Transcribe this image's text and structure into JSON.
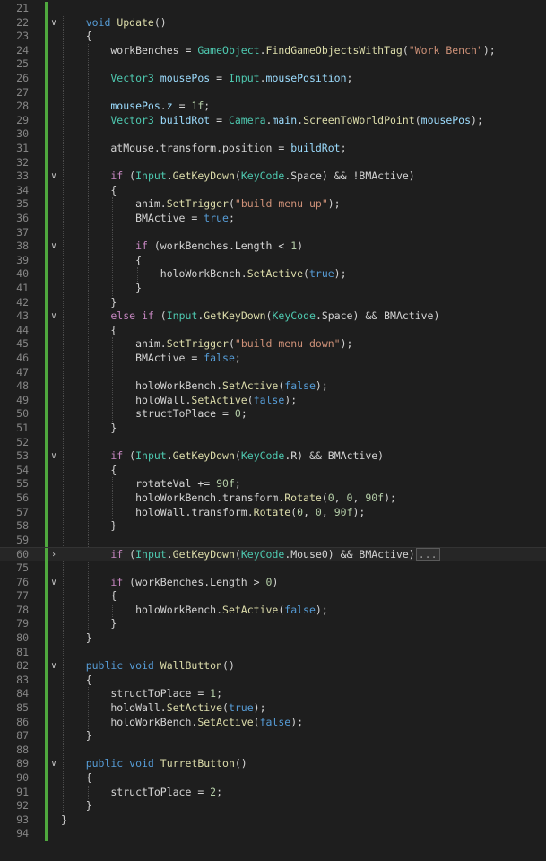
{
  "colors": {
    "background": "#1e1e1e",
    "line_number": "#858585",
    "git_modified_bar": "#4fa83e",
    "keyword": "#569cd6",
    "control": "#c586c0",
    "type": "#4ec9b0",
    "function": "#dcdcaa",
    "variable": "#9cdcfe",
    "string": "#ce9178",
    "number": "#b5cea8",
    "text": "#d4d4d4"
  },
  "editor": {
    "current_line": "60",
    "collapsed_marker": "...",
    "lines": [
      {
        "n": "21",
        "fold": "",
        "tokens": []
      },
      {
        "n": "22",
        "fold": "v",
        "tokens": [
          [
            "kw",
            "    void "
          ],
          [
            "fn",
            "Update"
          ],
          [
            "p",
            "()"
          ]
        ]
      },
      {
        "n": "23",
        "fold": "",
        "tokens": [
          [
            "p",
            "    {"
          ]
        ]
      },
      {
        "n": "24",
        "fold": "",
        "tokens": [
          [
            "p",
            "        workBenches = "
          ],
          [
            "ty",
            "GameObject"
          ],
          [
            "p",
            "."
          ],
          [
            "fn",
            "FindGameObjectsWithTag"
          ],
          [
            "p",
            "("
          ],
          [
            "str",
            "\"Work Bench\""
          ],
          [
            "p",
            ");"
          ]
        ]
      },
      {
        "n": "25",
        "fold": "",
        "tokens": []
      },
      {
        "n": "26",
        "fold": "",
        "tokens": [
          [
            "ty",
            "        Vector3 "
          ],
          [
            "var",
            "mousePos"
          ],
          [
            "p",
            " = "
          ],
          [
            "ty",
            "Input"
          ],
          [
            "p",
            "."
          ],
          [
            "var",
            "mousePosition"
          ],
          [
            "p",
            ";"
          ]
        ]
      },
      {
        "n": "27",
        "fold": "",
        "tokens": []
      },
      {
        "n": "28",
        "fold": "",
        "tokens": [
          [
            "var",
            "        mousePos"
          ],
          [
            "p",
            "."
          ],
          [
            "var",
            "z"
          ],
          [
            "p",
            " = "
          ],
          [
            "num",
            "1f"
          ],
          [
            "p",
            ";"
          ]
        ]
      },
      {
        "n": "29",
        "fold": "",
        "tokens": [
          [
            "ty",
            "        Vector3 "
          ],
          [
            "var",
            "buildRot"
          ],
          [
            "p",
            " = "
          ],
          [
            "ty",
            "Camera"
          ],
          [
            "p",
            "."
          ],
          [
            "var",
            "main"
          ],
          [
            "p",
            "."
          ],
          [
            "fn",
            "ScreenToWorldPoint"
          ],
          [
            "p",
            "("
          ],
          [
            "var",
            "mousePos"
          ],
          [
            "p",
            ");"
          ]
        ]
      },
      {
        "n": "30",
        "fold": "",
        "tokens": []
      },
      {
        "n": "31",
        "fold": "",
        "tokens": [
          [
            "p",
            "        atMouse.transform.position = "
          ],
          [
            "var",
            "buildRot"
          ],
          [
            "p",
            ";"
          ]
        ]
      },
      {
        "n": "32",
        "fold": "",
        "tokens": []
      },
      {
        "n": "33",
        "fold": "v",
        "tokens": [
          [
            "ctl",
            "        if "
          ],
          [
            "p",
            "("
          ],
          [
            "ty",
            "Input"
          ],
          [
            "p",
            "."
          ],
          [
            "fn",
            "GetKeyDown"
          ],
          [
            "p",
            "("
          ],
          [
            "ty",
            "KeyCode"
          ],
          [
            "p",
            ".Space) && !BMActive)"
          ]
        ]
      },
      {
        "n": "34",
        "fold": "",
        "tokens": [
          [
            "p",
            "        {"
          ]
        ]
      },
      {
        "n": "35",
        "fold": "",
        "tokens": [
          [
            "p",
            "            anim."
          ],
          [
            "fn",
            "SetTrigger"
          ],
          [
            "p",
            "("
          ],
          [
            "str",
            "\"build menu up\""
          ],
          [
            "p",
            ");"
          ]
        ]
      },
      {
        "n": "36",
        "fold": "",
        "tokens": [
          [
            "p",
            "            BMActive = "
          ],
          [
            "kw",
            "true"
          ],
          [
            "p",
            ";"
          ]
        ]
      },
      {
        "n": "37",
        "fold": "",
        "tokens": []
      },
      {
        "n": "38",
        "fold": "v",
        "tokens": [
          [
            "ctl",
            "            if "
          ],
          [
            "p",
            "(workBenches.Length < "
          ],
          [
            "num",
            "1"
          ],
          [
            "p",
            ")"
          ]
        ]
      },
      {
        "n": "39",
        "fold": "",
        "tokens": [
          [
            "p",
            "            {"
          ]
        ]
      },
      {
        "n": "40",
        "fold": "",
        "tokens": [
          [
            "p",
            "                holoWorkBench."
          ],
          [
            "fn",
            "SetActive"
          ],
          [
            "p",
            "("
          ],
          [
            "kw",
            "true"
          ],
          [
            "p",
            ");"
          ]
        ]
      },
      {
        "n": "41",
        "fold": "",
        "tokens": [
          [
            "p",
            "            }"
          ]
        ]
      },
      {
        "n": "42",
        "fold": "",
        "tokens": [
          [
            "p",
            "        }"
          ]
        ]
      },
      {
        "n": "43",
        "fold": "v",
        "tokens": [
          [
            "ctl",
            "        else if "
          ],
          [
            "p",
            "("
          ],
          [
            "ty",
            "Input"
          ],
          [
            "p",
            "."
          ],
          [
            "fn",
            "GetKeyDown"
          ],
          [
            "p",
            "("
          ],
          [
            "ty",
            "KeyCode"
          ],
          [
            "p",
            ".Space) && BMActive)"
          ]
        ]
      },
      {
        "n": "44",
        "fold": "",
        "tokens": [
          [
            "p",
            "        {"
          ]
        ]
      },
      {
        "n": "45",
        "fold": "",
        "tokens": [
          [
            "p",
            "            anim."
          ],
          [
            "fn",
            "SetTrigger"
          ],
          [
            "p",
            "("
          ],
          [
            "str",
            "\"build menu down\""
          ],
          [
            "p",
            ");"
          ]
        ]
      },
      {
        "n": "46",
        "fold": "",
        "tokens": [
          [
            "p",
            "            BMActive = "
          ],
          [
            "kw",
            "false"
          ],
          [
            "p",
            ";"
          ]
        ]
      },
      {
        "n": "47",
        "fold": "",
        "tokens": []
      },
      {
        "n": "48",
        "fold": "",
        "tokens": [
          [
            "p",
            "            holoWorkBench."
          ],
          [
            "fn",
            "SetActive"
          ],
          [
            "p",
            "("
          ],
          [
            "kw",
            "false"
          ],
          [
            "p",
            ");"
          ]
        ]
      },
      {
        "n": "49",
        "fold": "",
        "tokens": [
          [
            "p",
            "            holoWall."
          ],
          [
            "fn",
            "SetActive"
          ],
          [
            "p",
            "("
          ],
          [
            "kw",
            "false"
          ],
          [
            "p",
            ");"
          ]
        ]
      },
      {
        "n": "50",
        "fold": "",
        "tokens": [
          [
            "p",
            "            structToPlace = "
          ],
          [
            "num",
            "0"
          ],
          [
            "p",
            ";"
          ]
        ]
      },
      {
        "n": "51",
        "fold": "",
        "tokens": [
          [
            "p",
            "        }"
          ]
        ]
      },
      {
        "n": "52",
        "fold": "",
        "tokens": []
      },
      {
        "n": "53",
        "fold": "v",
        "tokens": [
          [
            "ctl",
            "        if "
          ],
          [
            "p",
            "("
          ],
          [
            "ty",
            "Input"
          ],
          [
            "p",
            "."
          ],
          [
            "fn",
            "GetKeyDown"
          ],
          [
            "p",
            "("
          ],
          [
            "ty",
            "KeyCode"
          ],
          [
            "p",
            ".R) && BMActive)"
          ]
        ]
      },
      {
        "n": "54",
        "fold": "",
        "tokens": [
          [
            "p",
            "        {"
          ]
        ]
      },
      {
        "n": "55",
        "fold": "",
        "tokens": [
          [
            "p",
            "            rotateVal += "
          ],
          [
            "num",
            "90f"
          ],
          [
            "p",
            ";"
          ]
        ]
      },
      {
        "n": "56",
        "fold": "",
        "tokens": [
          [
            "p",
            "            holoWorkBench.transform."
          ],
          [
            "fn",
            "Rotate"
          ],
          [
            "p",
            "("
          ],
          [
            "num",
            "0"
          ],
          [
            "p",
            ", "
          ],
          [
            "num",
            "0"
          ],
          [
            "p",
            ", "
          ],
          [
            "num",
            "90f"
          ],
          [
            "p",
            ");"
          ]
        ]
      },
      {
        "n": "57",
        "fold": "",
        "tokens": [
          [
            "p",
            "            holoWall.transform."
          ],
          [
            "fn",
            "Rotate"
          ],
          [
            "p",
            "("
          ],
          [
            "num",
            "0"
          ],
          [
            "p",
            ", "
          ],
          [
            "num",
            "0"
          ],
          [
            "p",
            ", "
          ],
          [
            "num",
            "90f"
          ],
          [
            "p",
            ");"
          ]
        ]
      },
      {
        "n": "58",
        "fold": "",
        "tokens": [
          [
            "p",
            "        }"
          ]
        ]
      },
      {
        "n": "59",
        "fold": "",
        "tokens": []
      },
      {
        "n": "60",
        "fold": ">",
        "tokens": [
          [
            "ctl",
            "        if "
          ],
          [
            "p",
            "("
          ],
          [
            "ty",
            "Input"
          ],
          [
            "p",
            "."
          ],
          [
            "fn",
            "GetKeyDown"
          ],
          [
            "p",
            "("
          ],
          [
            "ty",
            "KeyCode"
          ],
          [
            "p",
            ".Mouse0) && BMActive)"
          ]
        ]
      },
      {
        "n": "75",
        "fold": "",
        "tokens": []
      },
      {
        "n": "76",
        "fold": "v",
        "tokens": [
          [
            "ctl",
            "        if "
          ],
          [
            "p",
            "(workBenches.Length > "
          ],
          [
            "num",
            "0"
          ],
          [
            "p",
            ")"
          ]
        ]
      },
      {
        "n": "77",
        "fold": "",
        "tokens": [
          [
            "p",
            "        {"
          ]
        ]
      },
      {
        "n": "78",
        "fold": "",
        "tokens": [
          [
            "p",
            "            holoWorkBench."
          ],
          [
            "fn",
            "SetActive"
          ],
          [
            "p",
            "("
          ],
          [
            "kw",
            "false"
          ],
          [
            "p",
            ");"
          ]
        ]
      },
      {
        "n": "79",
        "fold": "",
        "tokens": [
          [
            "p",
            "        }"
          ]
        ]
      },
      {
        "n": "80",
        "fold": "",
        "tokens": [
          [
            "p",
            "    }"
          ]
        ]
      },
      {
        "n": "81",
        "fold": "",
        "tokens": []
      },
      {
        "n": "82",
        "fold": "v",
        "tokens": [
          [
            "kw",
            "    public void "
          ],
          [
            "fn",
            "WallButton"
          ],
          [
            "p",
            "()"
          ]
        ]
      },
      {
        "n": "83",
        "fold": "",
        "tokens": [
          [
            "p",
            "    {"
          ]
        ]
      },
      {
        "n": "84",
        "fold": "",
        "tokens": [
          [
            "p",
            "        structToPlace = "
          ],
          [
            "num",
            "1"
          ],
          [
            "p",
            ";"
          ]
        ]
      },
      {
        "n": "85",
        "fold": "",
        "tokens": [
          [
            "p",
            "        holoWall."
          ],
          [
            "fn",
            "SetActive"
          ],
          [
            "p",
            "("
          ],
          [
            "kw",
            "true"
          ],
          [
            "p",
            ");"
          ]
        ]
      },
      {
        "n": "86",
        "fold": "",
        "tokens": [
          [
            "p",
            "        holoWorkBench."
          ],
          [
            "fn",
            "SetActive"
          ],
          [
            "p",
            "("
          ],
          [
            "kw",
            "false"
          ],
          [
            "p",
            ");"
          ]
        ]
      },
      {
        "n": "87",
        "fold": "",
        "tokens": [
          [
            "p",
            "    }"
          ]
        ]
      },
      {
        "n": "88",
        "fold": "",
        "tokens": []
      },
      {
        "n": "89",
        "fold": "v",
        "tokens": [
          [
            "kw",
            "    public void "
          ],
          [
            "fn",
            "TurretButton"
          ],
          [
            "p",
            "()"
          ]
        ]
      },
      {
        "n": "90",
        "fold": "",
        "tokens": [
          [
            "p",
            "    {"
          ]
        ]
      },
      {
        "n": "91",
        "fold": "",
        "tokens": [
          [
            "p",
            "        structToPlace = "
          ],
          [
            "num",
            "2"
          ],
          [
            "p",
            ";"
          ]
        ]
      },
      {
        "n": "92",
        "fold": "",
        "tokens": [
          [
            "p",
            "    }"
          ]
        ]
      },
      {
        "n": "93",
        "fold": "",
        "tokens": [
          [
            "p",
            "}"
          ]
        ]
      },
      {
        "n": "94",
        "fold": "",
        "tokens": []
      }
    ]
  }
}
